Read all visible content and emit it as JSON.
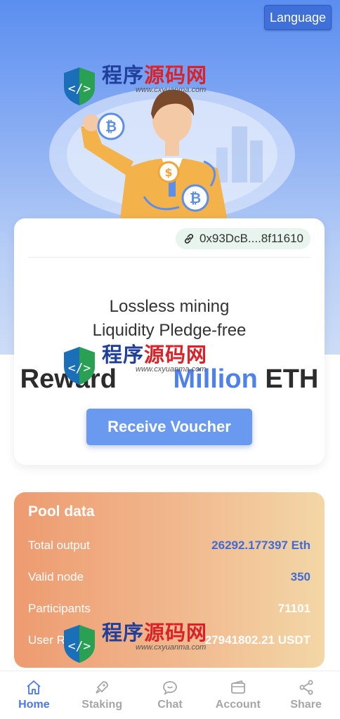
{
  "header": {
    "language_label": "Language"
  },
  "main_card": {
    "address": "0x93DcB....8f11610",
    "tagline_line1": "Lossless mining",
    "tagline_line2": "Liquidity Pledge-free",
    "reward_prefix": "Reward",
    "reward_highlight": "Million",
    "reward_suffix": "ETH",
    "voucher_button": "Receive Voucher"
  },
  "pool": {
    "title": "Pool data",
    "rows": [
      {
        "label": "Total output",
        "value": "26292.177397 Eth"
      },
      {
        "label": "Valid node",
        "value": "350"
      },
      {
        "label": "Participants",
        "value": "71101"
      },
      {
        "label": "User R",
        "value": "27941802.21 USDT"
      }
    ]
  },
  "nav": {
    "items": [
      {
        "label": "Home",
        "icon": "home-icon"
      },
      {
        "label": "Staking",
        "icon": "rocket-icon"
      },
      {
        "label": "Chat",
        "icon": "chat-icon"
      },
      {
        "label": "Account",
        "icon": "wallet-icon"
      },
      {
        "label": "Share",
        "icon": "share-icon"
      }
    ]
  },
  "watermark": {
    "brand_blue": "程序",
    "brand_red": "源码网",
    "url": "www.cxyuanma.com"
  },
  "colors": {
    "accent": "#4b78e6",
    "button": "#6a9af0",
    "pool_start": "#ee9b70",
    "pool_end": "#f3d7a6"
  }
}
